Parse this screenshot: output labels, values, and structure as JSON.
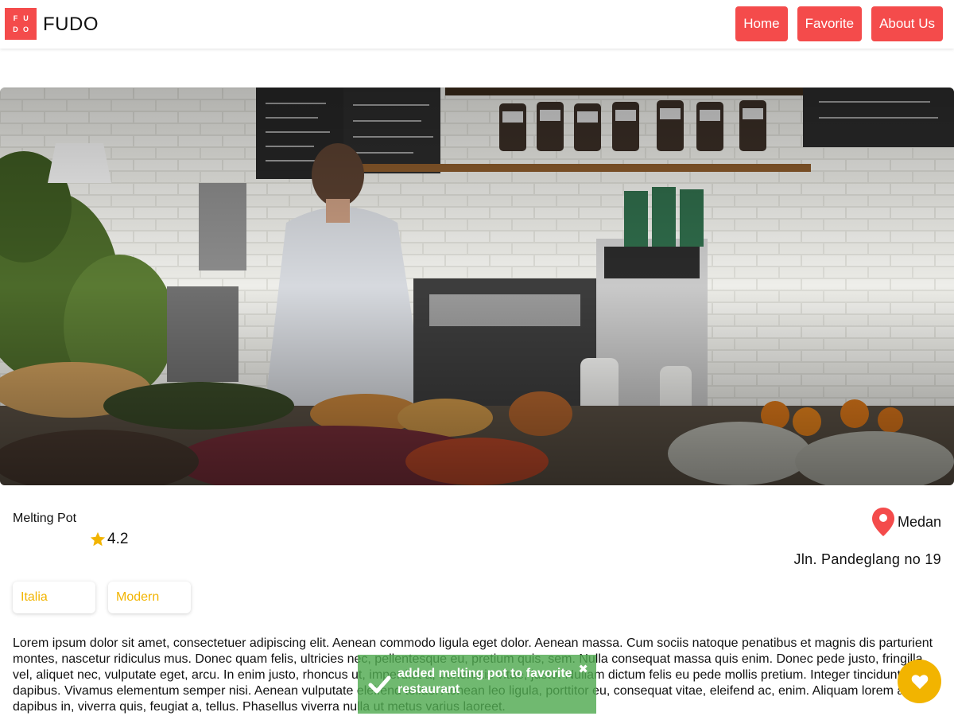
{
  "header": {
    "logo_letters": [
      "F",
      "U",
      "D",
      "O"
    ],
    "brand": "FUDO",
    "nav": [
      "Home",
      "Favorite",
      "About Us"
    ]
  },
  "restaurant": {
    "name": "Melting Pot",
    "rating": "4.2",
    "city": "Medan",
    "address": "Jln. Pandeglang no 19",
    "categories": [
      "Italia",
      "Modern"
    ],
    "description": "Lorem ipsum dolor sit amet, consectetuer adipiscing elit. Aenean commodo ligula eget dolor. Aenean massa. Cum sociis natoque penatibus et magnis dis parturient montes, nascetur ridiculus mus. Donec quam felis, ultricies nec, pellentesque eu, pretium quis, sem. Nulla consequat massa quis enim. Donec pede justo, fringilla vel, aliquet nec, vulputate eget, arcu. In enim justo, rhoncus ut, imperdiet a, venenatis vitae, justo. Nullam dictum felis eu pede mollis pretium. Integer tincidunt. Cras dapibus. Vivamus elementum semper nisi. Aenean vulputate eleifend tellus. Aenean leo ligula, porttitor eu, consequat vitae, eleifend ac, enim. Aliquam lorem ante, dapibus in, viverra quis, feugiat a, tellus. Phasellus viverra nulla ut metus varius laoreet."
  },
  "toast": {
    "message": "added melting pot to favorite restaurant",
    "close_symbol": "✖"
  },
  "colors": {
    "accent": "#f44b4b",
    "tag_text": "#f2b400",
    "fav_button": "#f2b400",
    "toast_bg": "#50aa50"
  },
  "icons": {
    "rating": "star-icon",
    "location": "map-pin-icon",
    "toast": "check-icon",
    "favorite": "heart-icon"
  }
}
